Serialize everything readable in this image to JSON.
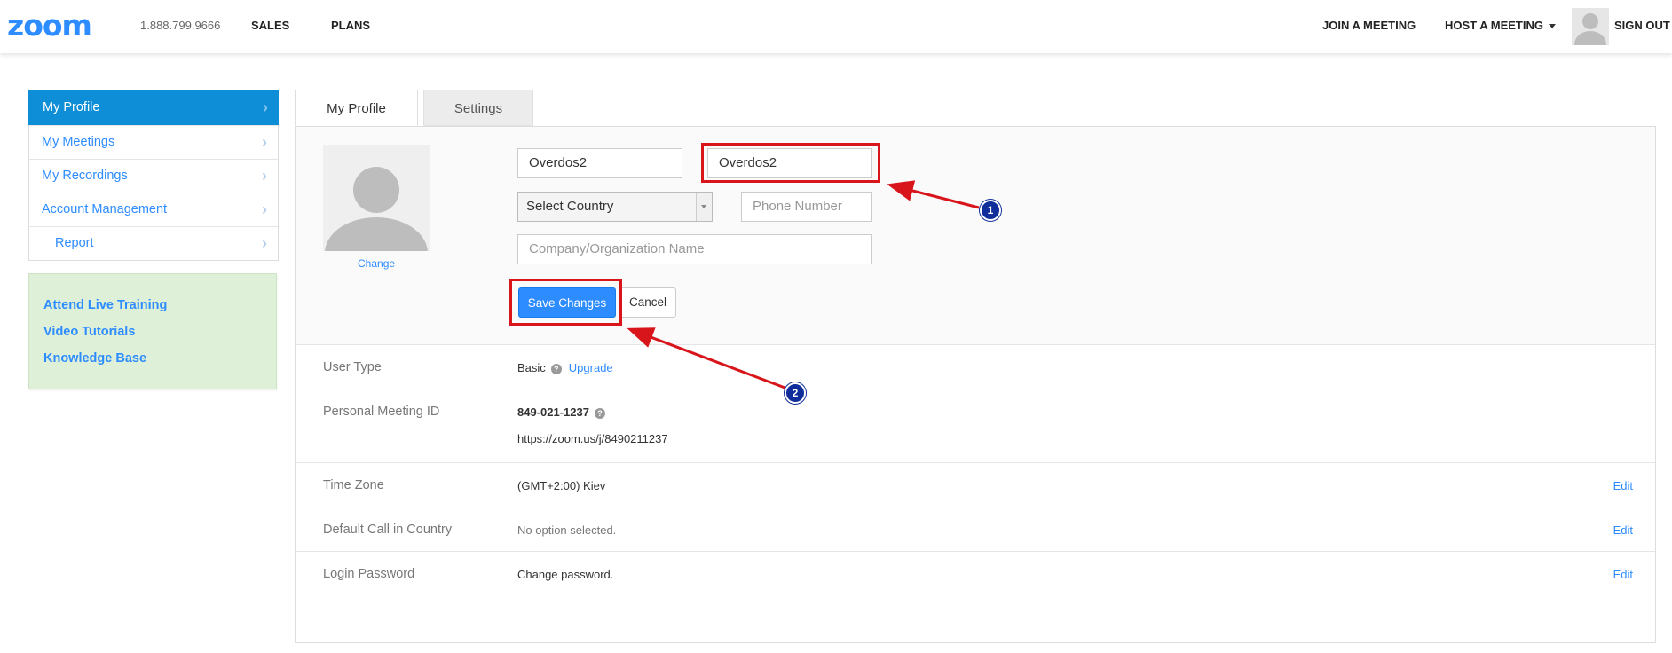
{
  "header": {
    "logo": "zoom",
    "phone": "1.888.799.9666",
    "nav_sales": "SALES",
    "nav_plans": "PLANS",
    "join": "JOIN A MEETING",
    "host": "HOST A MEETING",
    "signout": "SIGN OUT"
  },
  "sidebar": {
    "items": [
      {
        "label": "My Profile",
        "active": true
      },
      {
        "label": "My Meetings"
      },
      {
        "label": "My Recordings"
      },
      {
        "label": "Account Management"
      },
      {
        "label": "Report"
      }
    ],
    "help": [
      "Attend Live Training",
      "Video Tutorials",
      "Knowledge Base"
    ]
  },
  "tabs": {
    "profile": "My Profile",
    "settings": "Settings"
  },
  "profile_form": {
    "change_photo": "Change",
    "first_name": "Overdos2",
    "last_name": "Overdos2",
    "country": "Select Country",
    "phone_placeholder": "Phone Number",
    "company_placeholder": "Company/Organization Name",
    "save": "Save Changes",
    "cancel": "Cancel"
  },
  "rows": {
    "user_type": {
      "label": "User Type",
      "value": "Basic",
      "upgrade": "Upgrade"
    },
    "pmi": {
      "label": "Personal Meeting ID",
      "value": "849-021-1237",
      "url": "https://zoom.us/j/8490211237"
    },
    "time_zone": {
      "label": "Time Zone",
      "value": "(GMT+2:00) Kiev",
      "edit": "Edit"
    },
    "call_country": {
      "label": "Default Call in Country",
      "value": "No option selected.",
      "edit": "Edit"
    },
    "password": {
      "label": "Login Password",
      "value": "Change password.",
      "edit": "Edit"
    }
  },
  "annotations": {
    "badge_1": "1",
    "badge_2": "2",
    "color": "#d8151b"
  },
  "colors": {
    "accent": "#2d8cff",
    "sidebar_active": "#0e8ed7",
    "help_bg": "#dff0d8"
  }
}
